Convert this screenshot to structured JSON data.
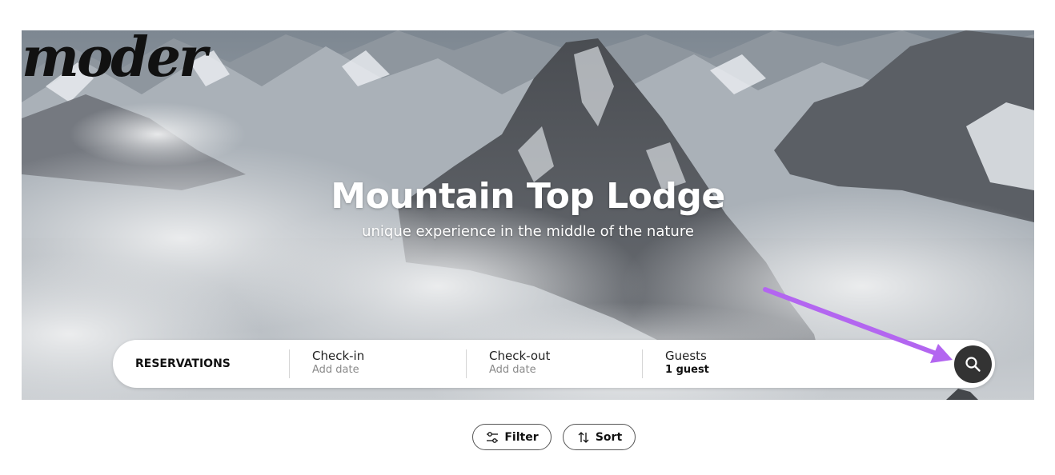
{
  "hero": {
    "logo_text": "moder",
    "title": "Mountain Top Lodge",
    "subtitle": "unique experience in the middle of the nature"
  },
  "searchbar": {
    "label": "RESERVATIONS",
    "fields": [
      {
        "title": "Check-in",
        "value": "Add date"
      },
      {
        "title": "Check-out",
        "value": "Add date"
      },
      {
        "title": "Guests",
        "value": "1 guest"
      }
    ],
    "search_icon": "search-icon"
  },
  "toolbar": {
    "filter_label": "Filter",
    "filter_icon": "sliders-icon",
    "sort_label": "Sort",
    "sort_icon": "sort-arrows-icon"
  },
  "annotation": {
    "arrow_color": "#b366f0"
  },
  "colors": {
    "search_button": "#333333",
    "text": "#111111"
  }
}
